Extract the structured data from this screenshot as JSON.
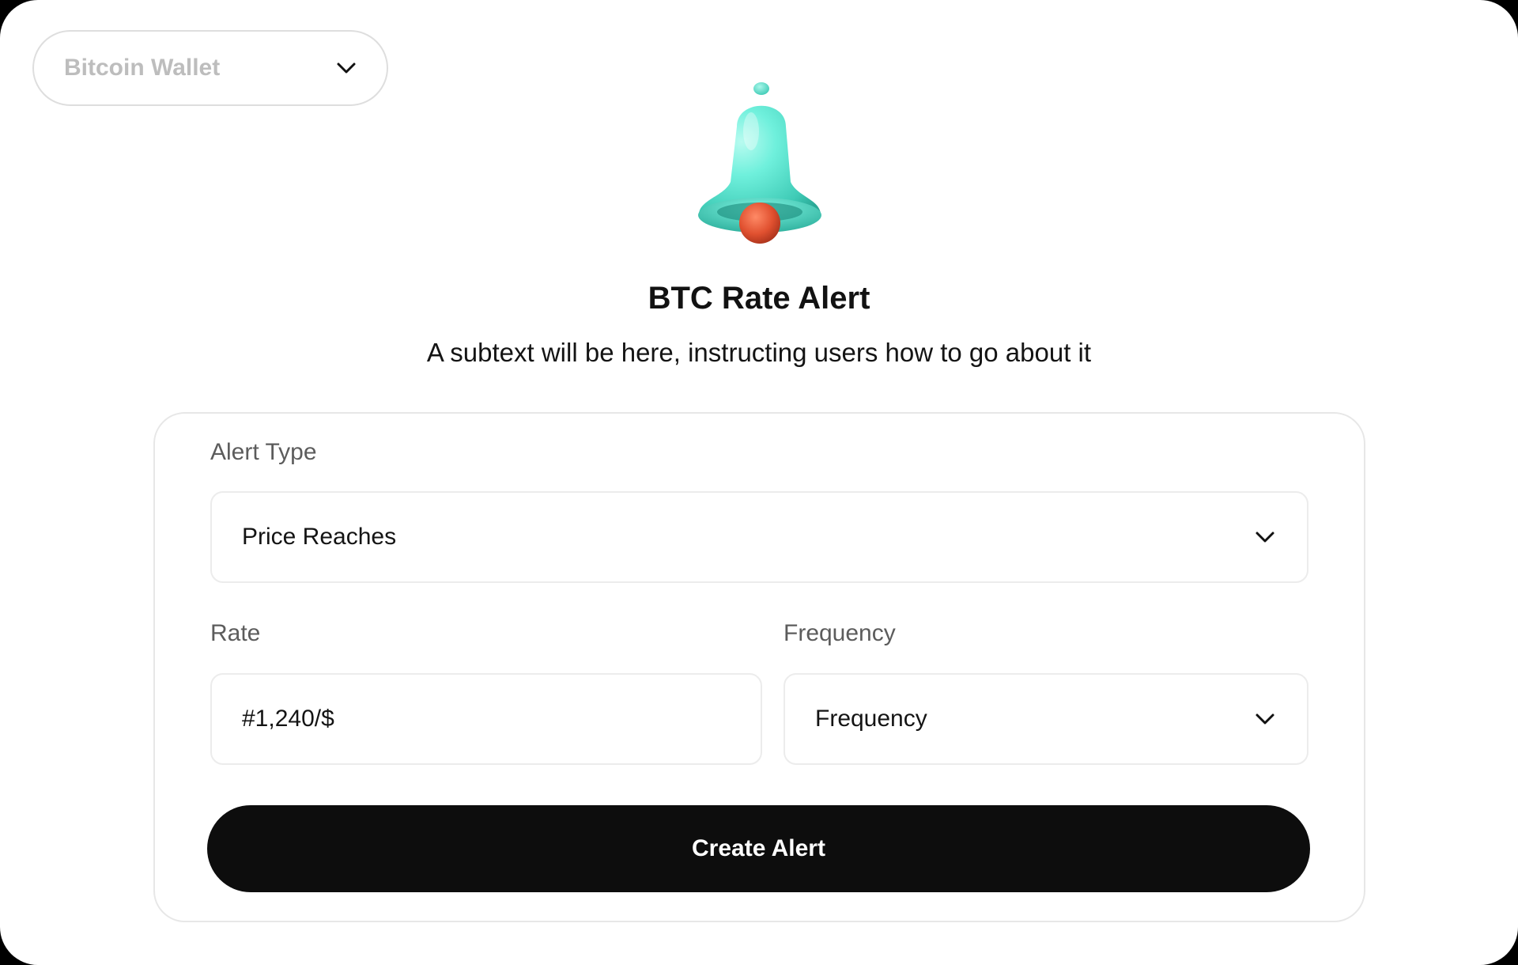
{
  "wallet_selector": {
    "label": "Bitcoin Wallet",
    "icon": "chevron-down-icon"
  },
  "hero": {
    "icon": "bell-icon",
    "title": "BTC Rate Alert",
    "subtitle": "A subtext will be here, instructing users how to go about it"
  },
  "form": {
    "alert_type": {
      "label": "Alert Type",
      "value": "Price Reaches",
      "icon": "chevron-down-icon"
    },
    "rate": {
      "label": "Rate",
      "value": "#1,240/$"
    },
    "frequency": {
      "label": "Frequency",
      "value": "Frequency",
      "icon": "chevron-down-icon"
    },
    "submit_label": "Create Alert"
  },
  "colors": {
    "bell": "#5ee6d2",
    "clapper": "#e0502f",
    "button": "#0d0d0d"
  }
}
